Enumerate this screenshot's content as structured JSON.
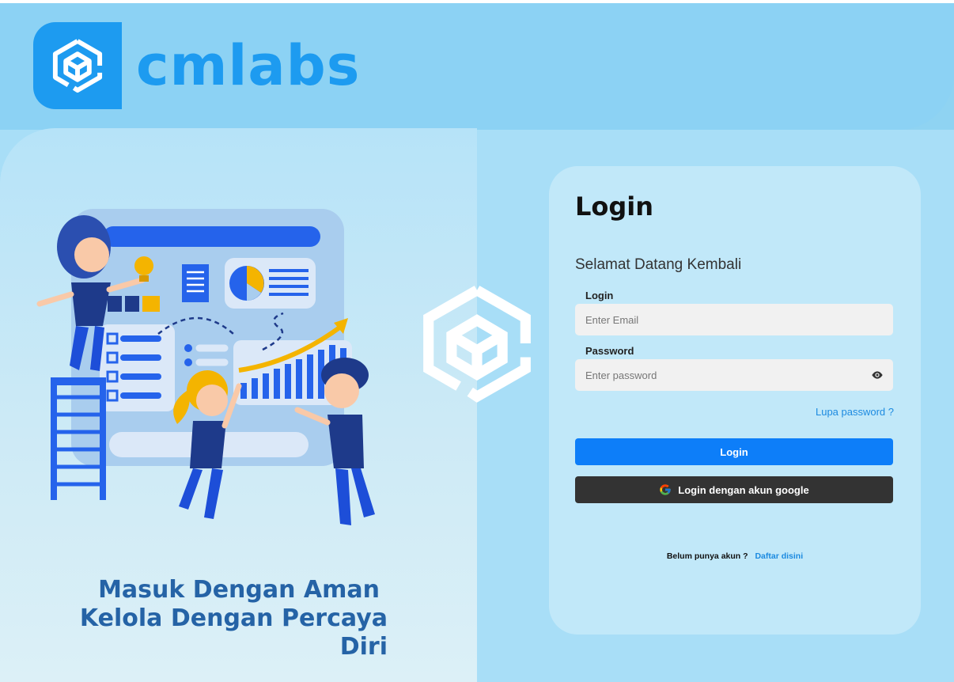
{
  "brand": {
    "name": "cmlabs",
    "logo_icon": "cube-hexagon-icon",
    "color": "#1d9bf0"
  },
  "hero": {
    "line1": "Masuk Dengan Aman",
    "line2": "Kelola Dengan Percaya Diri"
  },
  "login_card": {
    "title": "Login",
    "welcome": "Selamat Datang Kembali",
    "email": {
      "label": "Login",
      "placeholder": "Enter Email",
      "value": ""
    },
    "password": {
      "label": "Password",
      "placeholder": "Enter password",
      "value": "",
      "toggle_icon": "eye-icon"
    },
    "forgot_link": "Lupa password ?",
    "login_button": "Login",
    "google_button": "Login dengan akun google",
    "google_icon": "google-g-icon",
    "register_prompt": "Belum punya akun ?",
    "register_link": "Daftar disini"
  },
  "colors": {
    "primary_button": "#0d7ef9",
    "google_button": "#333333",
    "link": "#1c8ae0",
    "tagline": "#2563a6"
  }
}
